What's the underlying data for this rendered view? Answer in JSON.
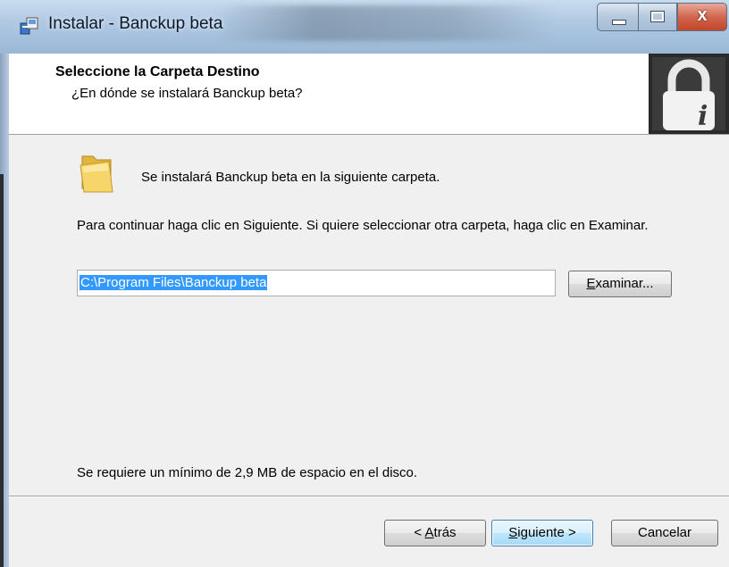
{
  "window": {
    "title": "Instalar - Banckup beta",
    "controls": {
      "close": "x"
    }
  },
  "header": {
    "title": "Seleccione la Carpeta Destino",
    "subtitle": "¿En dónde se instalará Banckup beta?"
  },
  "content": {
    "info": "Se instalará Banckup beta en la siguiente carpeta.",
    "instructions": "Para continuar haga clic en Siguiente. Si quiere seleccionar otra carpeta, haga clic en Examinar.",
    "path_value": "C:\\Program Files\\Banckup beta",
    "browse_button": {
      "prefix": "",
      "accel": "E",
      "rest": "xaminar..."
    },
    "space_required": "Se requiere un mínimo de 2,9 MB de espacio en el disco."
  },
  "buttons": {
    "back": {
      "prefix": "< ",
      "accel": "A",
      "rest": "trás"
    },
    "next": {
      "prefix": "",
      "accel": "S",
      "rest": "iguiente >"
    },
    "cancel": "Cancelar"
  },
  "icons": {
    "app": "installer-icon",
    "lock": "lock-info-icon",
    "folder": "folder-icon"
  },
  "colors": {
    "selection": "#3399ff",
    "title_bar": "#b0c9e3",
    "close_button": "#c14628"
  }
}
